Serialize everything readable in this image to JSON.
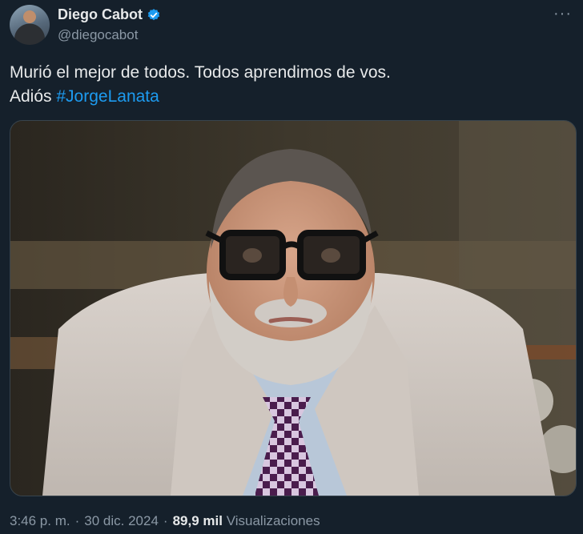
{
  "author": {
    "display_name": "Diego Cabot",
    "handle": "@diegocabot",
    "verified": true
  },
  "more_icon": "ellipsis-icon",
  "tweet": {
    "line1": "Murió el mejor de todos. Todos aprendimos de vos.",
    "line2_prefix": "Adiós ",
    "hashtag": "#JorgeLanata"
  },
  "meta": {
    "time": "3:46 p. m.",
    "separator": "·",
    "date": "30 dic. 2024",
    "views_count": "89,9 mil",
    "views_label": "Visualizaciones"
  },
  "colors": {
    "background": "#15202b",
    "accent": "#1d9bf0",
    "secondary_text": "#8b98a5"
  }
}
